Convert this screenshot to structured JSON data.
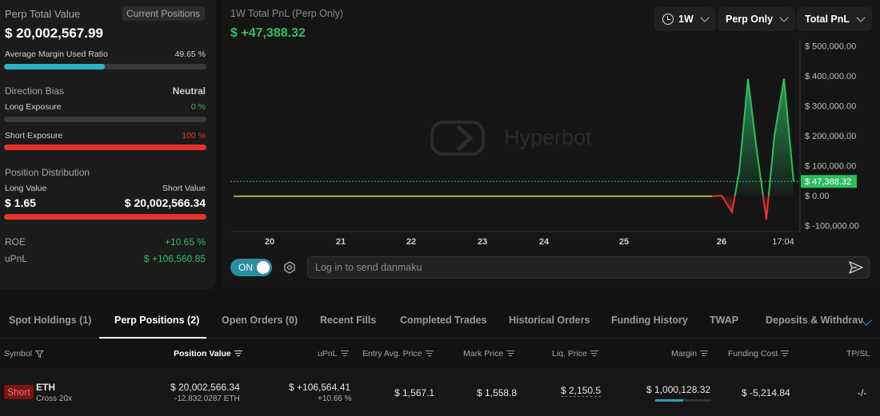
{
  "summary": {
    "perp_total_label": "Perp Total Value",
    "current_positions_label": "Current Positions",
    "perp_total_value": "$ 20,002,567.99",
    "avg_margin_label": "Average Margin Used Ratio",
    "avg_margin_value": "49.65 %",
    "avg_margin_fraction": 0.4965,
    "direction_bias_label": "Direction Bias",
    "direction_bias_value": "Neutral",
    "long_exposure_label": "Long Exposure",
    "long_exposure_value": "0 %",
    "long_exposure_fraction": 0,
    "short_exposure_label": "Short Exposure",
    "short_exposure_value": "100 %",
    "short_exposure_fraction": 1,
    "position_distribution_label": "Position Distribution",
    "long_value_label": "Long Value",
    "short_value_label": "Short Value",
    "long_value": "$ 1.65",
    "short_value": "$ 20,002,566.34",
    "roe_label": "ROE",
    "roe_value": "+10.65 %",
    "upnl_label": "uPnL",
    "upnl_value": "$ +106,560.85"
  },
  "chart_header": {
    "title": "1W Total PnL (Perp Only)",
    "value": "$ +47,388.32",
    "range_label": "1W",
    "filter_label": "Perp Only",
    "metric_label": "Total PnL",
    "watermark": "Hyperbot"
  },
  "chart_data": {
    "type": "area",
    "x_tick_labels": [
      "20",
      "21",
      "22",
      "23",
      "24",
      "25",
      "26",
      "17:04"
    ],
    "y_tick_labels": [
      "$ 500,000.00",
      "$ 400,000.00",
      "$ 300,000.00",
      "$ 200,000.00",
      "$ 100,000.00",
      "$ 0.00",
      "$ -100,000.00"
    ],
    "y_ticks": [
      500000,
      400000,
      300000,
      200000,
      100000,
      0,
      -100000
    ],
    "ylim": [
      -120000,
      520000
    ],
    "series": [
      {
        "values": [
          -2000,
          -2000,
          -2000,
          -2000,
          -2000,
          -2000,
          -2000,
          0,
          -55000,
          80000,
          390000,
          150000,
          -80000,
          200000,
          390000,
          47388.32
        ]
      }
    ],
    "current_value_label": "$ 47,388.32",
    "current_value": 47388.32,
    "positive_color": "#2ebd63",
    "negative_color": "#e5322d"
  },
  "danmaku": {
    "toggle_label": "ON",
    "placeholder": "Log in to send danmaku"
  },
  "tabs": [
    {
      "label": "Spot Holdings (1)"
    },
    {
      "label": "Perp Positions (2)"
    },
    {
      "label": "Open Orders (0)"
    },
    {
      "label": "Recent Fills"
    },
    {
      "label": "Completed Trades"
    },
    {
      "label": "Historical Orders"
    },
    {
      "label": "Funding History"
    },
    {
      "label": "TWAP"
    },
    {
      "label": "Deposits & Withdrav"
    }
  ],
  "table": {
    "headers": {
      "symbol": "Symbol",
      "position_value": "Position Value",
      "upnl": "uPnL",
      "entry": "Entry Avg. Price",
      "mark": "Mark Price",
      "liq": "Liq. Price",
      "margin": "Margin",
      "funding": "Funding Cost",
      "tpsl": "TP/SL"
    },
    "row": {
      "side": "Short",
      "coin": "ETH",
      "mode": "Cross 20x",
      "position_value": "$ 20,002,566.34",
      "position_size": "-12,832.0287 ETH",
      "upnl": "$ +106,564.41",
      "upnl_pct": "+10.66 %",
      "entry_price": "$ 1,567.1",
      "mark_price": "$ 1,558.8",
      "liq_price": "$ 2,150.5",
      "margin": "$ 1,000,128.32",
      "margin_fraction": 0.5,
      "funding_cost": "$ -5,214.84",
      "tpsl": "-/-"
    }
  }
}
